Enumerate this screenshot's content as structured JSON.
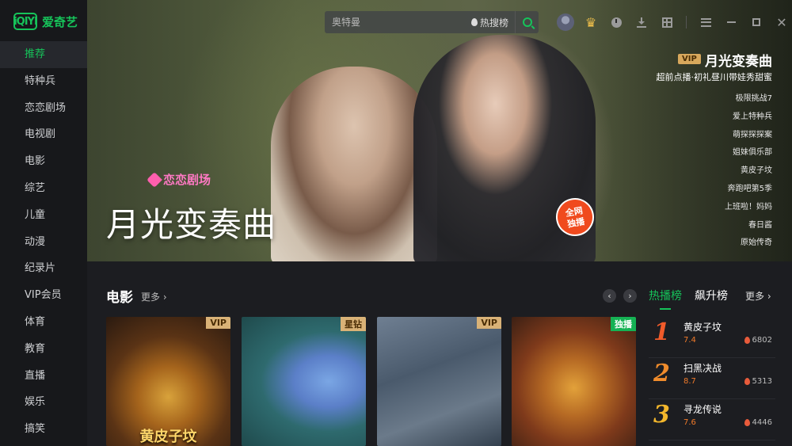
{
  "logo": {
    "mark": "iQIYI",
    "text": "爱奇艺"
  },
  "sidebar": {
    "items": [
      {
        "label": "推荐"
      },
      {
        "label": "特种兵"
      },
      {
        "label": "恋恋剧场"
      },
      {
        "label": "电视剧"
      },
      {
        "label": "电影"
      },
      {
        "label": "综艺"
      },
      {
        "label": "儿童"
      },
      {
        "label": "动漫"
      },
      {
        "label": "纪录片"
      },
      {
        "label": "VIP会员"
      },
      {
        "label": "体育"
      },
      {
        "label": "教育"
      },
      {
        "label": "直播"
      },
      {
        "label": "娱乐"
      },
      {
        "label": "搞笑"
      }
    ]
  },
  "search": {
    "placeholder": "奥特曼",
    "hot_label": "热搜榜"
  },
  "hero": {
    "badge_text": "恋恋剧场",
    "calligraphy_title": "月光变奏曲",
    "stamp_line1": "全网",
    "stamp_line2": "独播",
    "vip_label": "VIP",
    "title": "月光变奏曲",
    "subtitle": "超前点播·初礼昼川带娃秀甜蜜",
    "list": [
      "极限挑战7",
      "爱上特种兵",
      "萌探探探案",
      "姐妹俱乐部",
      "黄皮子坟",
      "奔跑吧第5季",
      "上班啦！妈妈",
      "春日酱",
      "原始传奇"
    ]
  },
  "section": {
    "title": "电影",
    "more_label": "更多",
    "prev_arrow": "‹",
    "next_arrow": "›"
  },
  "posters": [
    {
      "tag": "VIP",
      "title": "黄皮子坟"
    },
    {
      "tag": "星钻",
      "title": ""
    },
    {
      "tag": "VIP",
      "title": ""
    },
    {
      "tag": "独播",
      "title": ""
    }
  ],
  "ranking": {
    "tab_hot": "热播榜",
    "tab_rising": "飙升榜",
    "more_label": "更多",
    "items": [
      {
        "rank": "1",
        "name": "黄皮子坟",
        "score": "7.4",
        "hot": "6802"
      },
      {
        "rank": "2",
        "name": "扫黑决战",
        "score": "8.7",
        "hot": "5313"
      },
      {
        "rank": "3",
        "name": "寻龙传说",
        "score": "7.6",
        "hot": "4446"
      }
    ]
  },
  "colors": {
    "accent": "#16c35a",
    "vip_gold": "#d8a85c",
    "sidebar_bg": "#17181b",
    "page_bg": "#1c1d21"
  },
  "icons": [
    "search-icon",
    "avatar",
    "crown-icon",
    "clock-icon",
    "download-icon",
    "grid-icon",
    "menu-icon",
    "minimize-icon",
    "maximize-icon",
    "close-icon"
  ]
}
